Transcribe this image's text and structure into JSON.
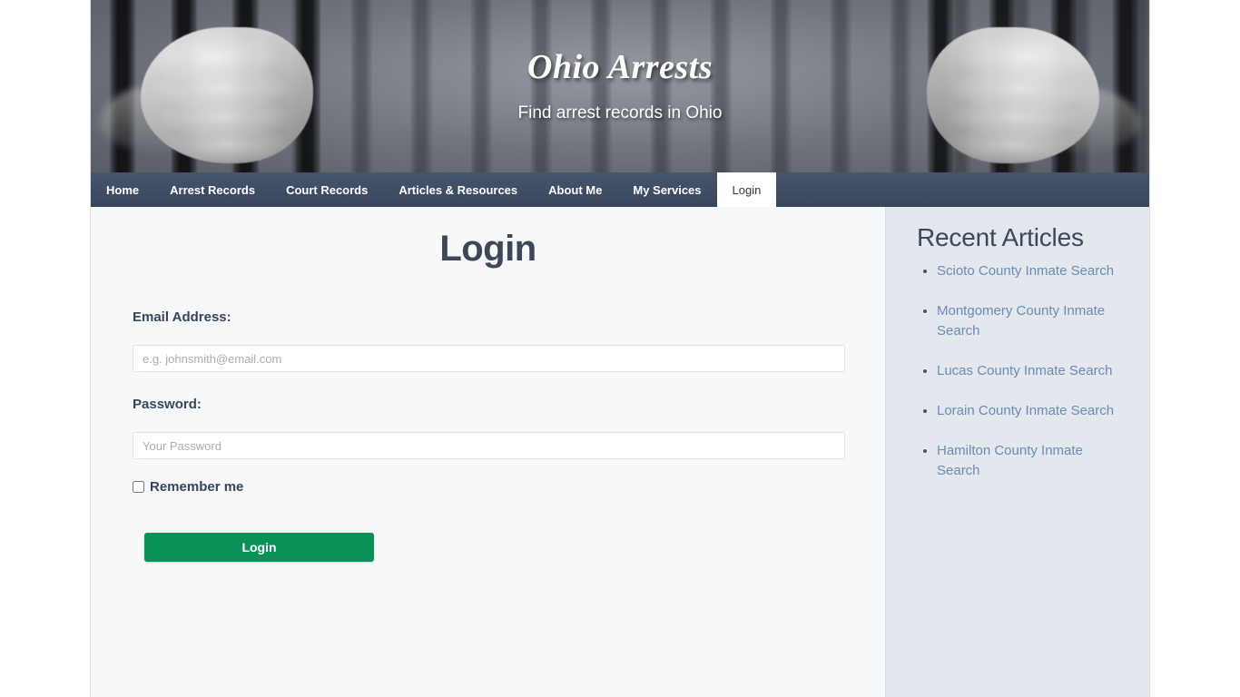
{
  "site": {
    "title": "Ohio Arrests",
    "tagline": "Find arrest records in Ohio"
  },
  "nav": {
    "items": [
      {
        "label": "Home",
        "active": false
      },
      {
        "label": "Arrest Records",
        "active": false
      },
      {
        "label": "Court Records",
        "active": false
      },
      {
        "label": "Articles & Resources",
        "active": false
      },
      {
        "label": "About Me",
        "active": false
      },
      {
        "label": "My Services",
        "active": false
      },
      {
        "label": "Login",
        "active": true
      }
    ]
  },
  "login": {
    "heading": "Login",
    "email_label": "Email Address:",
    "email_placeholder": "e.g. johnsmith@email.com",
    "email_value": "",
    "password_label": "Password:",
    "password_placeholder": "Your Password",
    "password_value": "",
    "remember_label": "Remember me",
    "remember_checked": false,
    "submit_label": "Login"
  },
  "sidebar": {
    "heading": "Recent Articles",
    "articles": [
      {
        "label": "Scioto County Inmate Search"
      },
      {
        "label": "Montgomery County Inmate Search"
      },
      {
        "label": "Lucas County Inmate Search"
      },
      {
        "label": "Lorain County Inmate Search"
      },
      {
        "label": "Hamilton County Inmate Search"
      }
    ]
  },
  "colors": {
    "nav_bg": "#3f4c63",
    "heading": "#3c4858",
    "button_green": "#0a9157",
    "link_blue": "#6b8ab4",
    "sidebar_bg": "#e3e7ee",
    "main_bg": "#f7f8f9"
  }
}
